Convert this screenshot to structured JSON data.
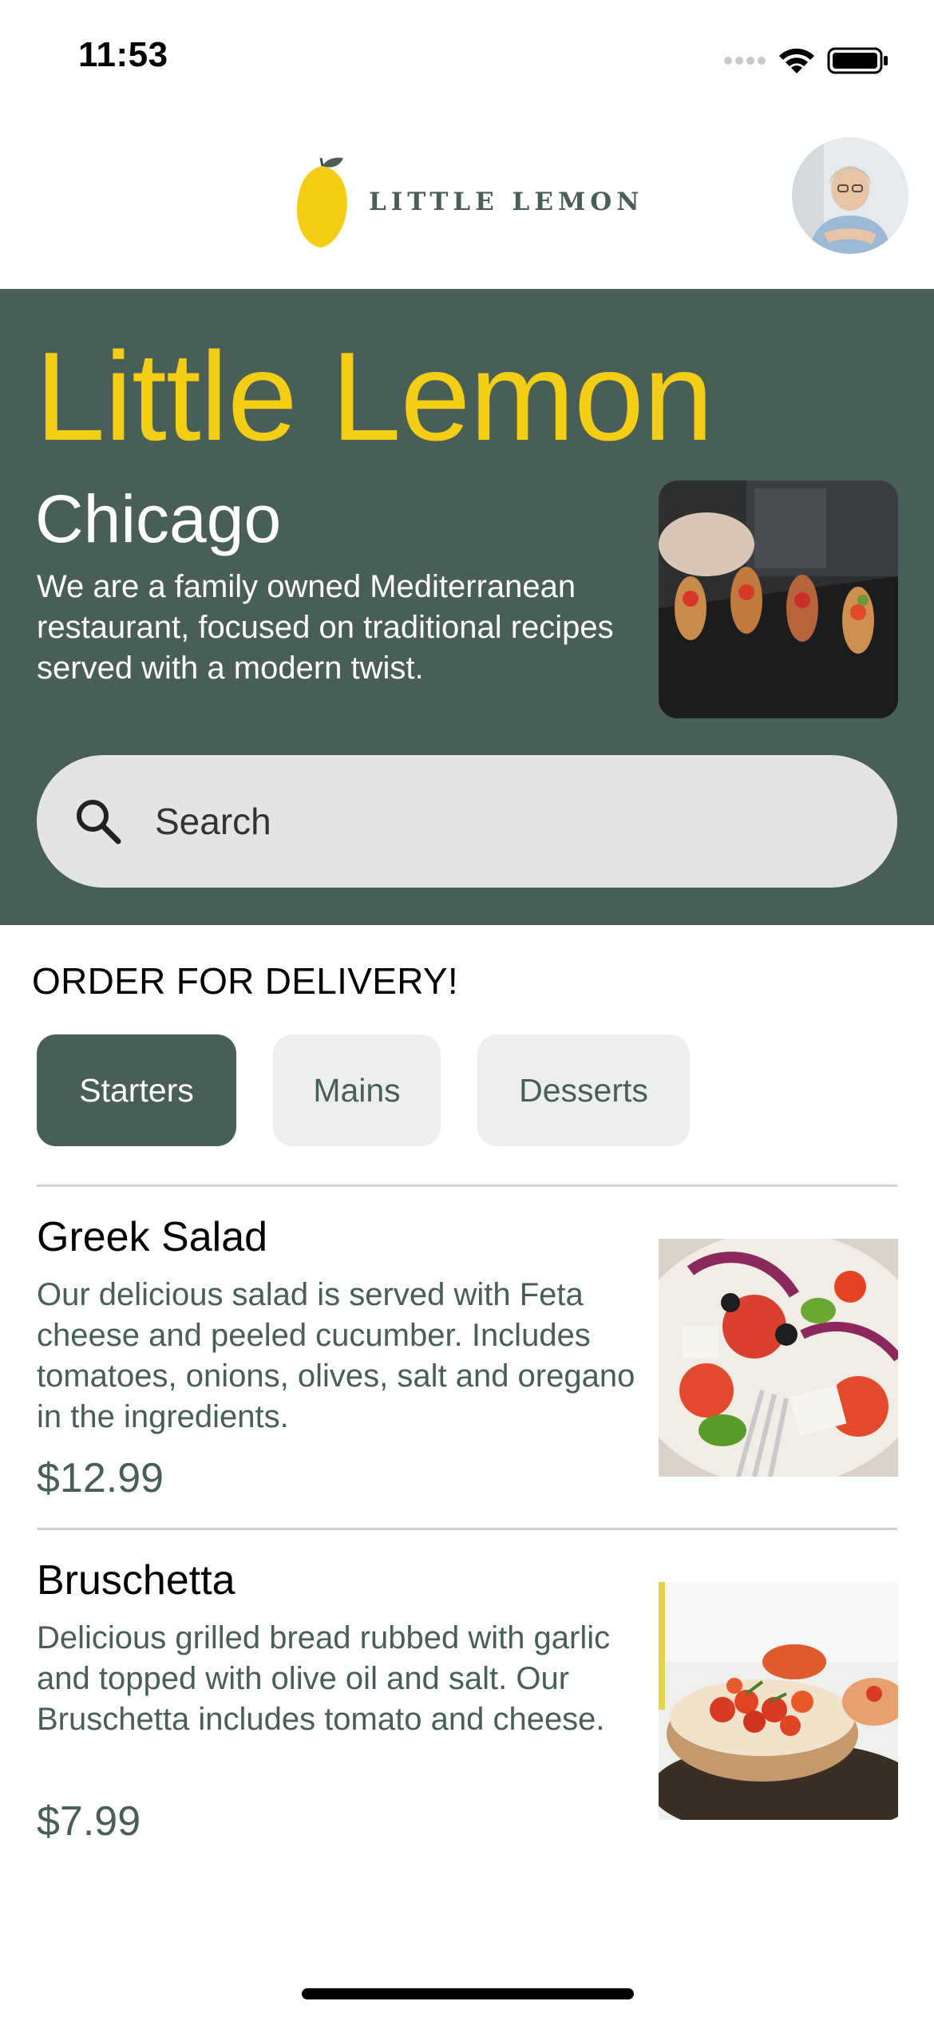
{
  "status_bar": {
    "time": "11:53"
  },
  "header": {
    "logo_text": "LITTLE LEMON",
    "logo_icon": "lemon-icon",
    "avatar_icon": "profile-avatar"
  },
  "hero": {
    "title": "Little Lemon",
    "city": "Chicago",
    "description": "We are a family owned Mediterranean restaurant, focused on traditional recipes served with a modern twist.",
    "search_placeholder": "Search"
  },
  "order": {
    "title": "ORDER FOR DELIVERY!",
    "categories": [
      {
        "label": "Starters",
        "selected": true
      },
      {
        "label": "Mains",
        "selected": false
      },
      {
        "label": "Desserts",
        "selected": false
      }
    ]
  },
  "menu_items": [
    {
      "name": "Greek Salad",
      "description": "Our delicious salad is served with Feta cheese and peeled cucumber. Includes tomatoes, onions, olives, salt and oregano in the ingredients.",
      "price": "$12.99"
    },
    {
      "name": "Bruschetta",
      "description": "Delicious grilled bread rubbed with garlic and topped with olive oil and salt. Our Bruschetta includes tomato and cheese.",
      "price": "$7.99"
    }
  ],
  "colors": {
    "primary_green": "#495e57",
    "primary_yellow": "#f4ce14",
    "chip_inactive": "#edefee",
    "search_bg": "#e4e4e4"
  }
}
